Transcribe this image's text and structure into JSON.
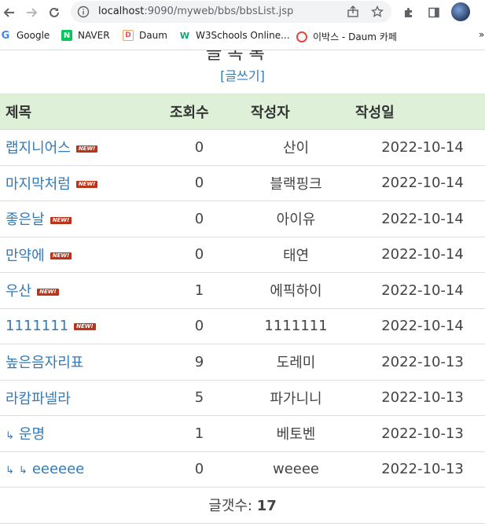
{
  "browser": {
    "url_host": "localhost",
    "url_path": ":9090/myweb/bbs/bbsList.jsp",
    "bookmarks": [
      {
        "label": "Google"
      },
      {
        "label": "NAVER"
      },
      {
        "label": "Daum"
      },
      {
        "label": "W3Schools Online..."
      },
      {
        "label": "이박스 - Daum 카페"
      }
    ],
    "more_label": "»"
  },
  "page": {
    "heading_partial": "글 목 록",
    "write_link": "[글쓰기]",
    "columns": [
      "제목",
      "조회수",
      "작성자",
      "작성일"
    ],
    "new_badge": "NEW!",
    "reply_mark": "↳",
    "rows": [
      {
        "title": "랩지니어스",
        "views": "0",
        "writer": "산이",
        "date": "2022-10-14",
        "is_new": true,
        "depth": 0
      },
      {
        "title": "마지막처럼",
        "views": "0",
        "writer": "블랙핑크",
        "date": "2022-10-14",
        "is_new": true,
        "depth": 0
      },
      {
        "title": "좋은날",
        "views": "0",
        "writer": "아이유",
        "date": "2022-10-14",
        "is_new": true,
        "depth": 0
      },
      {
        "title": "만약에",
        "views": "0",
        "writer": "태연",
        "date": "2022-10-14",
        "is_new": true,
        "depth": 0
      },
      {
        "title": "우산",
        "views": "1",
        "writer": "에픽하이",
        "date": "2022-10-14",
        "is_new": true,
        "depth": 0
      },
      {
        "title": "1111111",
        "views": "0",
        "writer": "1111111",
        "date": "2022-10-14",
        "is_new": true,
        "depth": 0
      },
      {
        "title": "높은음자리표",
        "views": "9",
        "writer": "도레미",
        "date": "2022-10-13",
        "is_new": false,
        "depth": 0
      },
      {
        "title": "라캄파넬라",
        "views": "5",
        "writer": "파가니니",
        "date": "2022-10-13",
        "is_new": false,
        "depth": 0
      },
      {
        "title": "운명",
        "views": "1",
        "writer": "베토벤",
        "date": "2022-10-13",
        "is_new": false,
        "depth": 1
      },
      {
        "title": "eeeeee",
        "views": "0",
        "writer": "weeee",
        "date": "2022-10-13",
        "is_new": false,
        "depth": 2
      }
    ],
    "total_label": "글갯수:",
    "total_count": "17"
  }
}
